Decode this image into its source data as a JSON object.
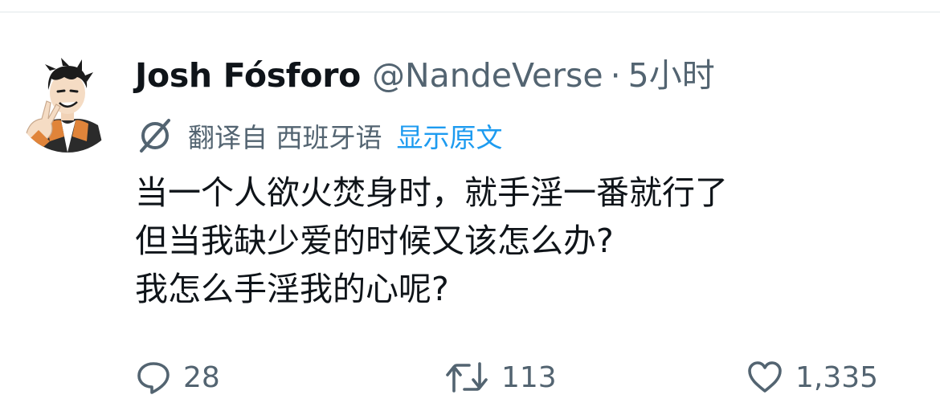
{
  "tweet": {
    "display_name": "Josh Fósforo",
    "handle": "@NandeVerse",
    "separator": "·",
    "time": "5小时",
    "translation": {
      "translated_from": "翻译自 西班牙语",
      "show_original": "显示原文",
      "icon": "translate-icon"
    },
    "body_lines": [
      "当一个人欲火焚身时，就手淫一番就行了",
      "但当我缺少爱的时候又该怎么办?",
      "我怎么手淫我的心呢?"
    ],
    "actions": {
      "replies": "28",
      "retweets": "113",
      "likes": "1,335"
    }
  },
  "colors": {
    "text_primary": "#0f1419",
    "text_secondary": "#536471",
    "link": "#1d9bf0",
    "divider": "#eff3f4"
  }
}
